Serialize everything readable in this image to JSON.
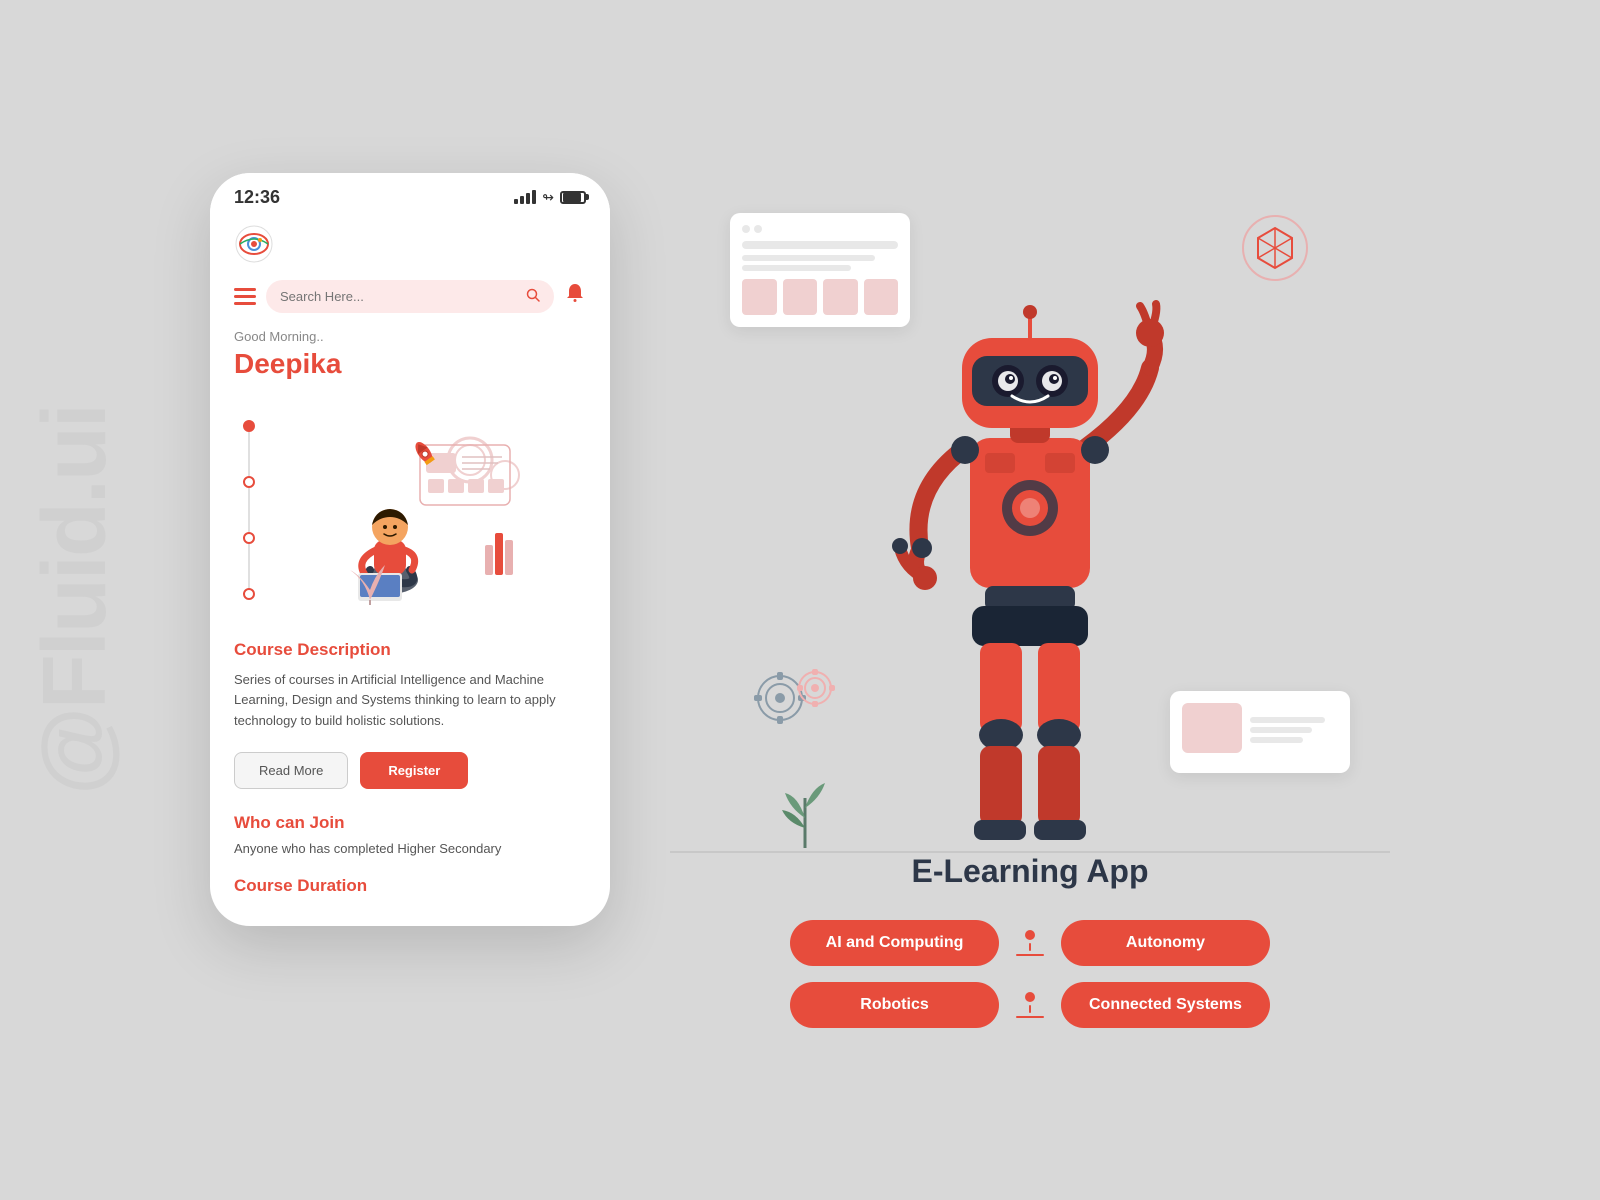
{
  "watermark": "@Fluid.ui",
  "phone": {
    "time": "12:36",
    "search_placeholder": "Search Here...",
    "greeting": "Good Morning..",
    "user_name": "Deepika",
    "course_description_title": "Course Description",
    "course_description_body": "Series of courses in Artificial Intelligence and Machine Learning, Design and Systems thinking to learn to apply technology to build holistic solutions.",
    "btn_read_more": "Read More",
    "btn_register": "Register",
    "who_join_title": "Who can Join",
    "who_join_body": "Anyone who has completed Higher Secondary",
    "course_duration_title": "Course Duration"
  },
  "right": {
    "app_title": "E-Learning App",
    "tags": [
      {
        "id": "ai",
        "label": "AI and Computing"
      },
      {
        "id": "autonomy",
        "label": "Autonomy"
      },
      {
        "id": "robotics",
        "label": "Robotics"
      },
      {
        "id": "connected",
        "label": "Connected Systems"
      }
    ]
  }
}
